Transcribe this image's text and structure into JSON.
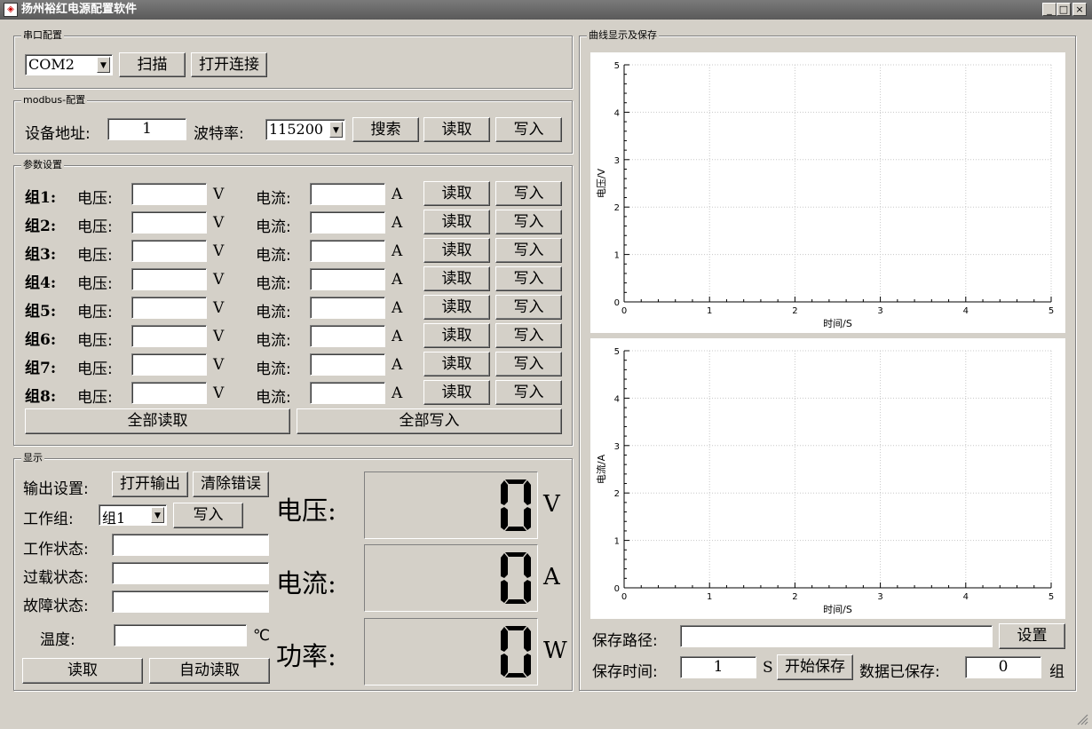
{
  "window": {
    "title": "扬州裕红电源配置软件",
    "buttons": [
      "_",
      "□",
      "×"
    ]
  },
  "serial": {
    "group_label": "串口配置",
    "port_value": "COM2",
    "scan_label": "扫描",
    "open_label": "打开连接"
  },
  "modbus": {
    "group_label": "modbus-配置",
    "addr_label": "设备地址:",
    "addr_value": "1",
    "baud_label": "波特率:",
    "baud_value": "115200",
    "search_label": "搜索",
    "read_label": "读取",
    "write_label": "写入"
  },
  "params": {
    "group_label": "参数设置",
    "rows": [
      {
        "name": "组1:",
        "v_label": "电压:",
        "v_value": "",
        "v_unit": "V",
        "i_label": "电流:",
        "i_value": "",
        "i_unit": "A",
        "read": "读取",
        "write": "写入"
      },
      {
        "name": "组2:",
        "v_label": "电压:",
        "v_value": "",
        "v_unit": "V",
        "i_label": "电流:",
        "i_value": "",
        "i_unit": "A",
        "read": "读取",
        "write": "写入"
      },
      {
        "name": "组3:",
        "v_label": "电压:",
        "v_value": "",
        "v_unit": "V",
        "i_label": "电流:",
        "i_value": "",
        "i_unit": "A",
        "read": "读取",
        "write": "写入"
      },
      {
        "name": "组4:",
        "v_label": "电压:",
        "v_value": "",
        "v_unit": "V",
        "i_label": "电流:",
        "i_value": "",
        "i_unit": "A",
        "read": "读取",
        "write": "写入"
      },
      {
        "name": "组5:",
        "v_label": "电压:",
        "v_value": "",
        "v_unit": "V",
        "i_label": "电流:",
        "i_value": "",
        "i_unit": "A",
        "read": "读取",
        "write": "写入"
      },
      {
        "name": "组6:",
        "v_label": "电压:",
        "v_value": "",
        "v_unit": "V",
        "i_label": "电流:",
        "i_value": "",
        "i_unit": "A",
        "read": "读取",
        "write": "写入"
      },
      {
        "name": "组7:",
        "v_label": "电压:",
        "v_value": "",
        "v_unit": "V",
        "i_label": "电流:",
        "i_value": "",
        "i_unit": "A",
        "read": "读取",
        "write": "写入"
      },
      {
        "name": "组8:",
        "v_label": "电压:",
        "v_value": "",
        "v_unit": "V",
        "i_label": "电流:",
        "i_value": "",
        "i_unit": "A",
        "read": "读取",
        "write": "写入"
      }
    ],
    "read_all": "全部读取",
    "write_all": "全部写入"
  },
  "display": {
    "group_label": "显示",
    "output_label": "输出设置:",
    "open_output": "打开输出",
    "clear_error": "清除错误",
    "work_group_label": "工作组:",
    "work_group_value": "组1",
    "write_label": "写入",
    "work_state_label": "工作状态:",
    "work_state_value": "",
    "overload_label": "过载状态:",
    "overload_value": "",
    "fault_label": "故障状态:",
    "fault_value": "",
    "temp_label": "温度:",
    "temp_value": "",
    "temp_unit": "℃",
    "read_label": "读取",
    "auto_read_label": "自动读取",
    "voltage_label": "电压:",
    "voltage_value": "0",
    "voltage_unit": "V",
    "current_label": "电流:",
    "current_value": "0",
    "current_unit": "A",
    "power_label": "功率:",
    "power_value": "0",
    "power_unit": "W"
  },
  "curve": {
    "group_label": "曲线显示及保存",
    "save_path_label": "保存路径:",
    "save_path_value": "",
    "set_label": "设置",
    "save_time_label": "保存时间:",
    "save_time_value": "1",
    "save_time_unit": "S",
    "start_save_label": "开始保存",
    "saved_label": "数据已保存:",
    "saved_value": "0",
    "saved_unit": "组"
  },
  "chart_data": [
    {
      "type": "line",
      "xlabel": "时间/S",
      "ylabel": "电压/V",
      "xlim": [
        0,
        5
      ],
      "ylim": [
        0,
        5
      ],
      "xticks": [
        "0",
        "1",
        "2",
        "3",
        "4",
        "5"
      ],
      "yticks": [
        "0",
        "1",
        "2",
        "3",
        "4",
        "5"
      ],
      "grid": true,
      "series": []
    },
    {
      "type": "line",
      "xlabel": "时间/S",
      "ylabel": "电流/A",
      "xlim": [
        0,
        5
      ],
      "ylim": [
        0,
        5
      ],
      "xticks": [
        "0",
        "1",
        "2",
        "3",
        "4",
        "5"
      ],
      "yticks": [
        "0",
        "1",
        "2",
        "3",
        "4",
        "5"
      ],
      "grid": true,
      "series": []
    }
  ]
}
